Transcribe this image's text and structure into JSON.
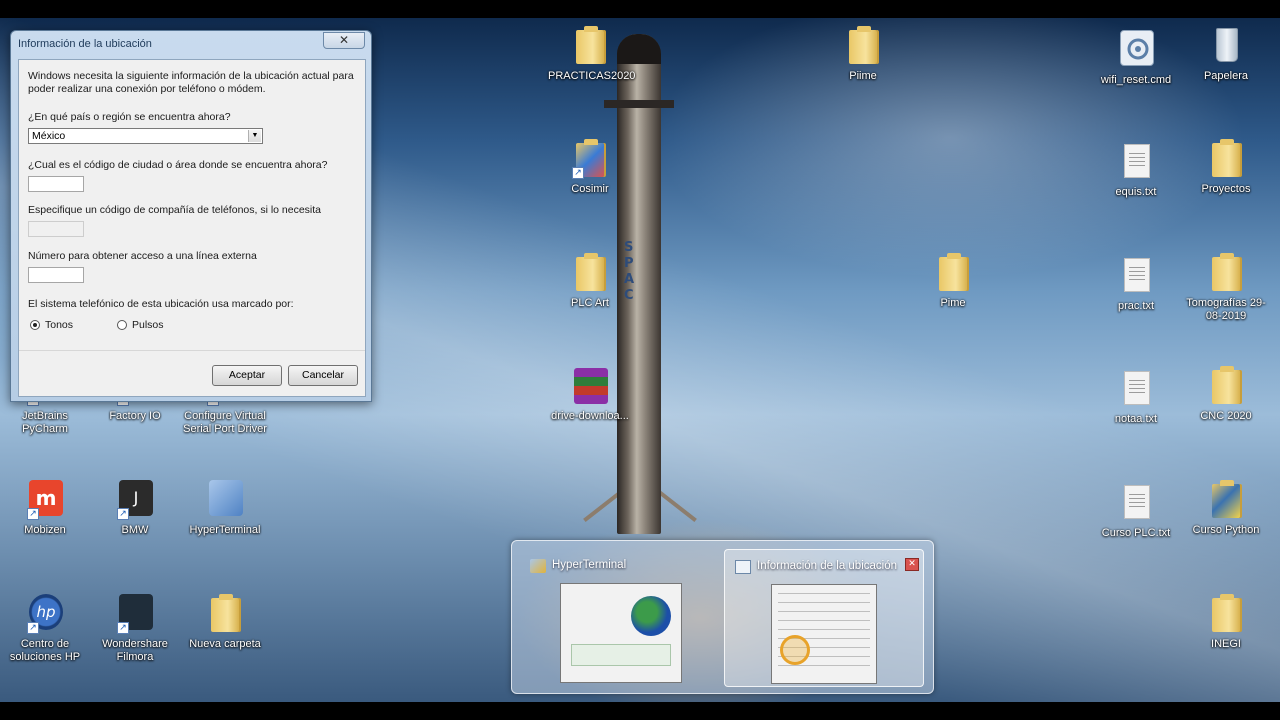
{
  "dialog": {
    "title": "Información de la ubicación",
    "close_label": "✕",
    "intro": "Windows necesita la siguiente información de la ubicación actual para poder realizar una conexión por teléfono o módem.",
    "country_question": "¿En qué país o región se encuentra ahora?",
    "country_value": "México",
    "area_question": "¿Cual es el código de ciudad o área donde se encuentra ahora?",
    "area_value": "",
    "carrier_question": "Especifique un código de compañía de teléfonos, si lo necesita",
    "carrier_value": "",
    "outside_question": "Número para obtener acceso a una línea externa",
    "outside_value": "",
    "dialing_question": "El sistema telefónico de esta ubicación usa marcado por:",
    "dialing_options": [
      {
        "label": "Tonos",
        "checked": true
      },
      {
        "label": "Pulsos",
        "checked": false
      }
    ],
    "accept_label": "Aceptar",
    "cancel_label": "Cancelar"
  },
  "desktop_icons": [
    {
      "label": "PRACTICAS2020",
      "icon": "folder-icon"
    },
    {
      "label": "Piime",
      "icon": "folder-icon"
    },
    {
      "label": "wifi_reset.cmd",
      "icon": "cmd-file-icon"
    },
    {
      "label": "Papelera",
      "icon": "recycle-bin-icon"
    },
    {
      "label": "Cosimir",
      "icon": "folder-icon"
    },
    {
      "label": "equis.txt",
      "icon": "text-file-icon"
    },
    {
      "label": "Proyectos",
      "icon": "folder-icon"
    },
    {
      "label": "PLC Art",
      "icon": "folder-icon"
    },
    {
      "label": "Pime",
      "icon": "folder-icon"
    },
    {
      "label": "prac.txt",
      "icon": "text-file-icon"
    },
    {
      "label": "Tomografías 29-08-2019",
      "icon": "folder-icon"
    },
    {
      "label": "drive-downloa...",
      "icon": "winrar-archive-icon"
    },
    {
      "label": "notaa.txt",
      "icon": "text-file-icon"
    },
    {
      "label": "CNC 2020",
      "icon": "folder-icon"
    },
    {
      "label": "JetBrains PyCharm",
      "icon": "pycharm-icon"
    },
    {
      "label": "Factory IO",
      "icon": "factory-io-icon"
    },
    {
      "label": "Configure Virtual Serial Port Driver",
      "icon": "serial-port-icon"
    },
    {
      "label": "Curso PLC.txt",
      "icon": "text-file-icon"
    },
    {
      "label": "Curso Python",
      "icon": "folder-icon"
    },
    {
      "label": "Mobizen",
      "icon": "mobizen-icon"
    },
    {
      "label": "BMW",
      "icon": "bmw-app-icon"
    },
    {
      "label": "HyperTerminal",
      "icon": "hyperterminal-icon"
    },
    {
      "label": "Centro de soluciones HP",
      "icon": "hp-icon"
    },
    {
      "label": "Wondershare Filmora",
      "icon": "filmora-icon"
    },
    {
      "label": "Nueva carpeta",
      "icon": "folder-icon"
    },
    {
      "label": "INEGI",
      "icon": "folder-icon"
    }
  ],
  "switcher": {
    "items": [
      {
        "title": "HyperTerminal",
        "icon": "hyperterminal-icon"
      },
      {
        "title": "Información de la ubicación",
        "icon": "window-icon"
      }
    ],
    "close_label": "✕"
  },
  "rocket_text": "SPACE"
}
